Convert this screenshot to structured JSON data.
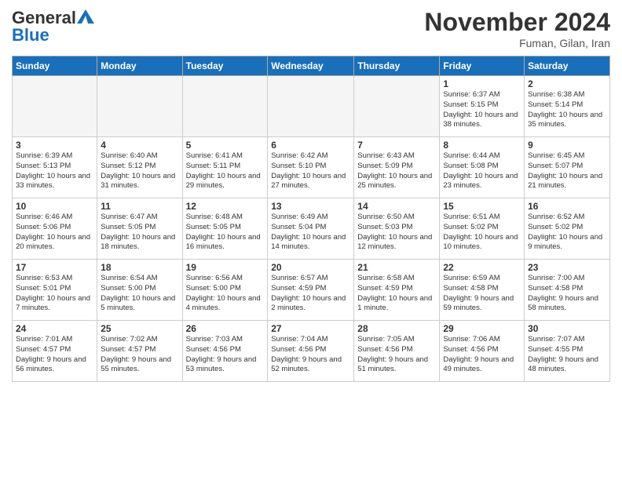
{
  "header": {
    "logo_general": "General",
    "logo_blue": "Blue",
    "month_title": "November 2024",
    "location": "Fuman, Gilan, Iran"
  },
  "weekdays": [
    "Sunday",
    "Monday",
    "Tuesday",
    "Wednesday",
    "Thursday",
    "Friday",
    "Saturday"
  ],
  "weeks": [
    [
      {
        "day": "",
        "empty": true
      },
      {
        "day": "",
        "empty": true
      },
      {
        "day": "",
        "empty": true
      },
      {
        "day": "",
        "empty": true
      },
      {
        "day": "",
        "empty": true
      },
      {
        "day": "1",
        "sunrise": "Sunrise: 6:37 AM",
        "sunset": "Sunset: 5:15 PM",
        "daylight": "Daylight: 10 hours and 38 minutes."
      },
      {
        "day": "2",
        "sunrise": "Sunrise: 6:38 AM",
        "sunset": "Sunset: 5:14 PM",
        "daylight": "Daylight: 10 hours and 35 minutes."
      }
    ],
    [
      {
        "day": "3",
        "sunrise": "Sunrise: 6:39 AM",
        "sunset": "Sunset: 5:13 PM",
        "daylight": "Daylight: 10 hours and 33 minutes."
      },
      {
        "day": "4",
        "sunrise": "Sunrise: 6:40 AM",
        "sunset": "Sunset: 5:12 PM",
        "daylight": "Daylight: 10 hours and 31 minutes."
      },
      {
        "day": "5",
        "sunrise": "Sunrise: 6:41 AM",
        "sunset": "Sunset: 5:11 PM",
        "daylight": "Daylight: 10 hours and 29 minutes."
      },
      {
        "day": "6",
        "sunrise": "Sunrise: 6:42 AM",
        "sunset": "Sunset: 5:10 PM",
        "daylight": "Daylight: 10 hours and 27 minutes."
      },
      {
        "day": "7",
        "sunrise": "Sunrise: 6:43 AM",
        "sunset": "Sunset: 5:09 PM",
        "daylight": "Daylight: 10 hours and 25 minutes."
      },
      {
        "day": "8",
        "sunrise": "Sunrise: 6:44 AM",
        "sunset": "Sunset: 5:08 PM",
        "daylight": "Daylight: 10 hours and 23 minutes."
      },
      {
        "day": "9",
        "sunrise": "Sunrise: 6:45 AM",
        "sunset": "Sunset: 5:07 PM",
        "daylight": "Daylight: 10 hours and 21 minutes."
      }
    ],
    [
      {
        "day": "10",
        "sunrise": "Sunrise: 6:46 AM",
        "sunset": "Sunset: 5:06 PM",
        "daylight": "Daylight: 10 hours and 20 minutes."
      },
      {
        "day": "11",
        "sunrise": "Sunrise: 6:47 AM",
        "sunset": "Sunset: 5:05 PM",
        "daylight": "Daylight: 10 hours and 18 minutes."
      },
      {
        "day": "12",
        "sunrise": "Sunrise: 6:48 AM",
        "sunset": "Sunset: 5:05 PM",
        "daylight": "Daylight: 10 hours and 16 minutes."
      },
      {
        "day": "13",
        "sunrise": "Sunrise: 6:49 AM",
        "sunset": "Sunset: 5:04 PM",
        "daylight": "Daylight: 10 hours and 14 minutes."
      },
      {
        "day": "14",
        "sunrise": "Sunrise: 6:50 AM",
        "sunset": "Sunset: 5:03 PM",
        "daylight": "Daylight: 10 hours and 12 minutes."
      },
      {
        "day": "15",
        "sunrise": "Sunrise: 6:51 AM",
        "sunset": "Sunset: 5:02 PM",
        "daylight": "Daylight: 10 hours and 10 minutes."
      },
      {
        "day": "16",
        "sunrise": "Sunrise: 6:52 AM",
        "sunset": "Sunset: 5:02 PM",
        "daylight": "Daylight: 10 hours and 9 minutes."
      }
    ],
    [
      {
        "day": "17",
        "sunrise": "Sunrise: 6:53 AM",
        "sunset": "Sunset: 5:01 PM",
        "daylight": "Daylight: 10 hours and 7 minutes."
      },
      {
        "day": "18",
        "sunrise": "Sunrise: 6:54 AM",
        "sunset": "Sunset: 5:00 PM",
        "daylight": "Daylight: 10 hours and 5 minutes."
      },
      {
        "day": "19",
        "sunrise": "Sunrise: 6:56 AM",
        "sunset": "Sunset: 5:00 PM",
        "daylight": "Daylight: 10 hours and 4 minutes."
      },
      {
        "day": "20",
        "sunrise": "Sunrise: 6:57 AM",
        "sunset": "Sunset: 4:59 PM",
        "daylight": "Daylight: 10 hours and 2 minutes."
      },
      {
        "day": "21",
        "sunrise": "Sunrise: 6:58 AM",
        "sunset": "Sunset: 4:59 PM",
        "daylight": "Daylight: 10 hours and 1 minute."
      },
      {
        "day": "22",
        "sunrise": "Sunrise: 6:59 AM",
        "sunset": "Sunset: 4:58 PM",
        "daylight": "Daylight: 9 hours and 59 minutes."
      },
      {
        "day": "23",
        "sunrise": "Sunrise: 7:00 AM",
        "sunset": "Sunset: 4:58 PM",
        "daylight": "Daylight: 9 hours and 58 minutes."
      }
    ],
    [
      {
        "day": "24",
        "sunrise": "Sunrise: 7:01 AM",
        "sunset": "Sunset: 4:57 PM",
        "daylight": "Daylight: 9 hours and 56 minutes."
      },
      {
        "day": "25",
        "sunrise": "Sunrise: 7:02 AM",
        "sunset": "Sunset: 4:57 PM",
        "daylight": "Daylight: 9 hours and 55 minutes."
      },
      {
        "day": "26",
        "sunrise": "Sunrise: 7:03 AM",
        "sunset": "Sunset: 4:56 PM",
        "daylight": "Daylight: 9 hours and 53 minutes."
      },
      {
        "day": "27",
        "sunrise": "Sunrise: 7:04 AM",
        "sunset": "Sunset: 4:56 PM",
        "daylight": "Daylight: 9 hours and 52 minutes."
      },
      {
        "day": "28",
        "sunrise": "Sunrise: 7:05 AM",
        "sunset": "Sunset: 4:56 PM",
        "daylight": "Daylight: 9 hours and 51 minutes."
      },
      {
        "day": "29",
        "sunrise": "Sunrise: 7:06 AM",
        "sunset": "Sunset: 4:56 PM",
        "daylight": "Daylight: 9 hours and 49 minutes."
      },
      {
        "day": "30",
        "sunrise": "Sunrise: 7:07 AM",
        "sunset": "Sunset: 4:55 PM",
        "daylight": "Daylight: 9 hours and 48 minutes."
      }
    ]
  ]
}
